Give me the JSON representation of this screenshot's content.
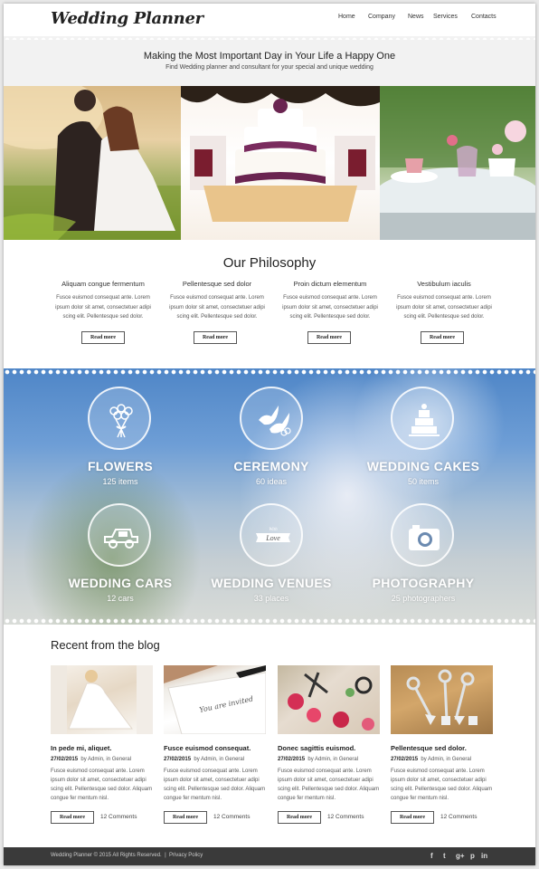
{
  "header": {
    "logo": "Wedding Planner",
    "nav": [
      "Home",
      "Company",
      "News",
      "Services",
      "Contacts"
    ]
  },
  "hero": {
    "title": "Making the Most Important Day in Your Life a Happy One",
    "subtitle": "Find Wedding planner and consultant for your special and unique wedding"
  },
  "philosophy": {
    "title": "Our Philosophy",
    "columns": [
      {
        "title": "Aliquam congue fermentum",
        "text": "Fusce euismod consequat ante. Lorem ipsum dolor sit amet, consectetuer adipi scing elit. Pellentesque sed dolor.",
        "button": "Read more"
      },
      {
        "title": "Pellentesque sed dolor",
        "text": "Fusce euismod consequat ante. Lorem ipsum dolor sit amet, consectetuer adipi scing elit. Pellentesque sed dolor.",
        "button": "Read more"
      },
      {
        "title": "Proin dictum elementum",
        "text": "Fusce euismod consequat ante. Lorem ipsum dolor sit amet, consectetuer adipi scing elit. Pellentesque sed dolor.",
        "button": "Read more"
      },
      {
        "title": "Vestibulum iaculis",
        "text": "Fusce euismod consequat ante. Lorem ipsum dolor sit amet, consectetuer adipi scing elit. Pellentesque sed dolor.",
        "button": "Read more"
      }
    ]
  },
  "services": [
    {
      "title": "FLOWERS",
      "count": "125 items",
      "icon": "bouquet-icon"
    },
    {
      "title": "CEREMONY",
      "count": "60 ideas",
      "icon": "doves-icon"
    },
    {
      "title": "WEDDING CAKES",
      "count": "50 items",
      "icon": "cake-icon"
    },
    {
      "title": "WEDDING CARS",
      "count": "12 cars",
      "icon": "car-icon"
    },
    {
      "title": "WEDDING VENUES",
      "count": "33 places",
      "icon": "love-sign-icon",
      "icon_text_small": "With",
      "icon_text": "Love"
    },
    {
      "title": "PHOTOGRAPHY",
      "count": "25 photographers",
      "icon": "camera-icon"
    }
  ],
  "blog": {
    "title": "Recent from the blog",
    "posts": [
      {
        "title": "In pede mi, aliquet.",
        "date": "27/02/2015",
        "by": "by Admin, in General",
        "text": "Fusce euismod consequat ante. Lorem ipsum dolor sit amet, consectetuer adipi scing elit. Pellentesque sed dolor. Aliquam congue fer mentum nisl.",
        "button": "Read more",
        "comments": "12 Comments"
      },
      {
        "title": "Fusce euismod consequat.",
        "date": "27/02/2015",
        "by": "by Admin, in General",
        "text": "Fusce euismod consequat ante. Lorem ipsum dolor sit amet, consectetuer adipi scing elit. Pellentesque sed dolor. Aliquam congue fer mentum nisl.",
        "button": "Read more",
        "comments": "12 Comments"
      },
      {
        "title": "Donec sagittis euismod.",
        "date": "27/02/2015",
        "by": "by Admin, in General",
        "text": "Fusce euismod consequat ante. Lorem ipsum dolor sit amet, consectetuer adipi scing elit. Pellentesque sed dolor. Aliquam congue fer mentum nisl.",
        "button": "Read more",
        "comments": "12 Comments"
      },
      {
        "title": "Pellentesque sed dolor.",
        "date": "27/02/2015",
        "by": "by Admin, in General",
        "text": "Fusce euismod consequat ante. Lorem ipsum dolor sit amet, consectetuer adipi scing elit. Pellentesque sed dolor. Aliquam congue fer mentum nisl.",
        "button": "Read more",
        "comments": "12 Comments"
      }
    ],
    "image_texts": {
      "invited": "You are invited"
    }
  },
  "footer": {
    "copyright": "Wedding Planner © 2015 All Rights Reserved.",
    "separator": "|",
    "privacy": "Privacy Policy",
    "social": [
      "f",
      "t",
      "g+",
      "p",
      "in"
    ]
  }
}
